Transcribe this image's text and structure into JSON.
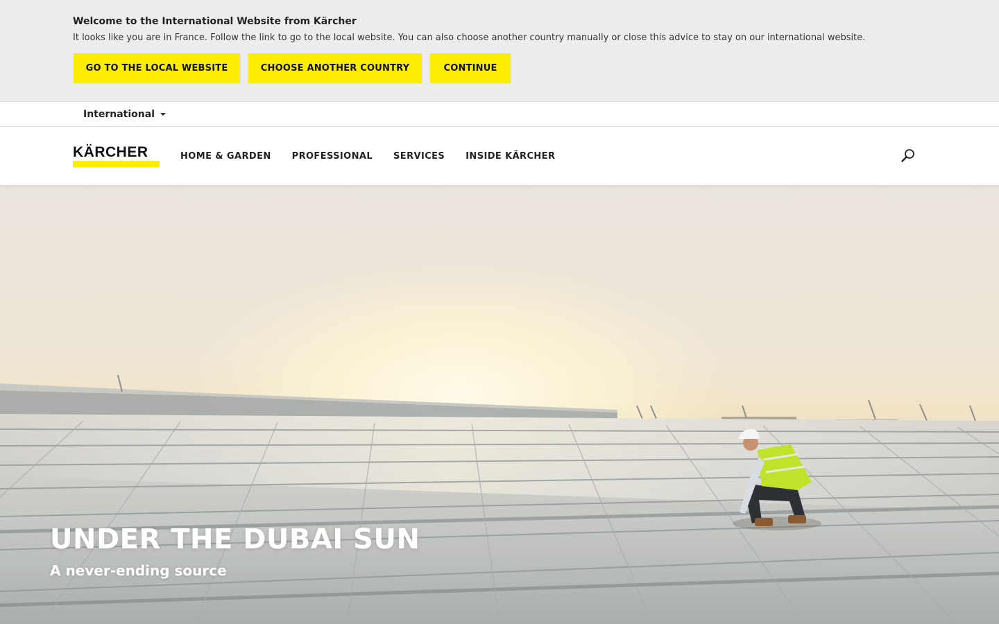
{
  "advice": {
    "title": "Welcome to the International Website from Kärcher",
    "text": "It looks like you are in France. Follow the link to go to the local website. You can also choose another country manually or close this advice to stay on our international website.",
    "buttons": {
      "local": "GO TO THE LOCAL WEBSITE",
      "country": "CHOOSE ANOTHER COUNTRY",
      "continue": "CONTINUE"
    },
    "button_color": "#ffed00"
  },
  "locale": {
    "selected": "International",
    "icon": "caret-down-icon"
  },
  "header": {
    "logo_text": "KÄRCHER",
    "brand_color": "#ffed00",
    "nav": [
      {
        "label": "HOME & GARDEN"
      },
      {
        "label": "PROFESSIONAL"
      },
      {
        "label": "SERVICES"
      },
      {
        "label": "INSIDE KÄRCHER"
      }
    ],
    "search_icon": "search-icon"
  },
  "hero": {
    "title": "UNDER THE DUBAI SUN",
    "subtitle": "A never-ending source"
  }
}
